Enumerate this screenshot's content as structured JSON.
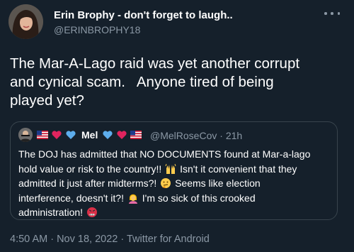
{
  "tweet": {
    "author": {
      "display_name": "Erin Brophy - don't forget to laugh..",
      "handle": "@ERINBROPHY18",
      "avatar_icon": "profile-photo"
    },
    "more_icon": "more-horizontal-icon",
    "text": "The Mar-A-Lago raid was yet another corrupt\nand cynical scam.   Anyone tired of being\nplayed yet?",
    "quote": {
      "author": {
        "display_name": "Mel",
        "handle": "@MelRoseCov",
        "time_ago": "21h",
        "separator": "·",
        "name_decorations": [
          "us-flag-emoji",
          "red-heart-emoji",
          "blue-heart-emoji",
          "blue-heart-emoji",
          "red-heart-emoji",
          "us-flag-emoji"
        ]
      },
      "lines": {
        "l1": "The DOJ has admitted that NO DOCUMENTS found at Mar-a-lago",
        "l2a": "hold value or risk to the country!!",
        "l2b": "Isn't it convenient that they",
        "l3a": "admitted it just after midterms?!",
        "l3b": "Seems like election",
        "l4a": "interference, doesn't it?!",
        "l4b": "I'm so sick of this crooked",
        "l5a": "administration!"
      },
      "emojis": [
        "raising-hands-emoji",
        "thinking-face-emoji",
        "facepalm-emoji",
        "angry-face-emoji"
      ]
    },
    "meta": "4:50 AM · Nov 18, 2022 · Twitter for Android"
  },
  "colors": {
    "background": "#15202b",
    "secondary_text": "#8b98a5",
    "border": "#38444d"
  }
}
